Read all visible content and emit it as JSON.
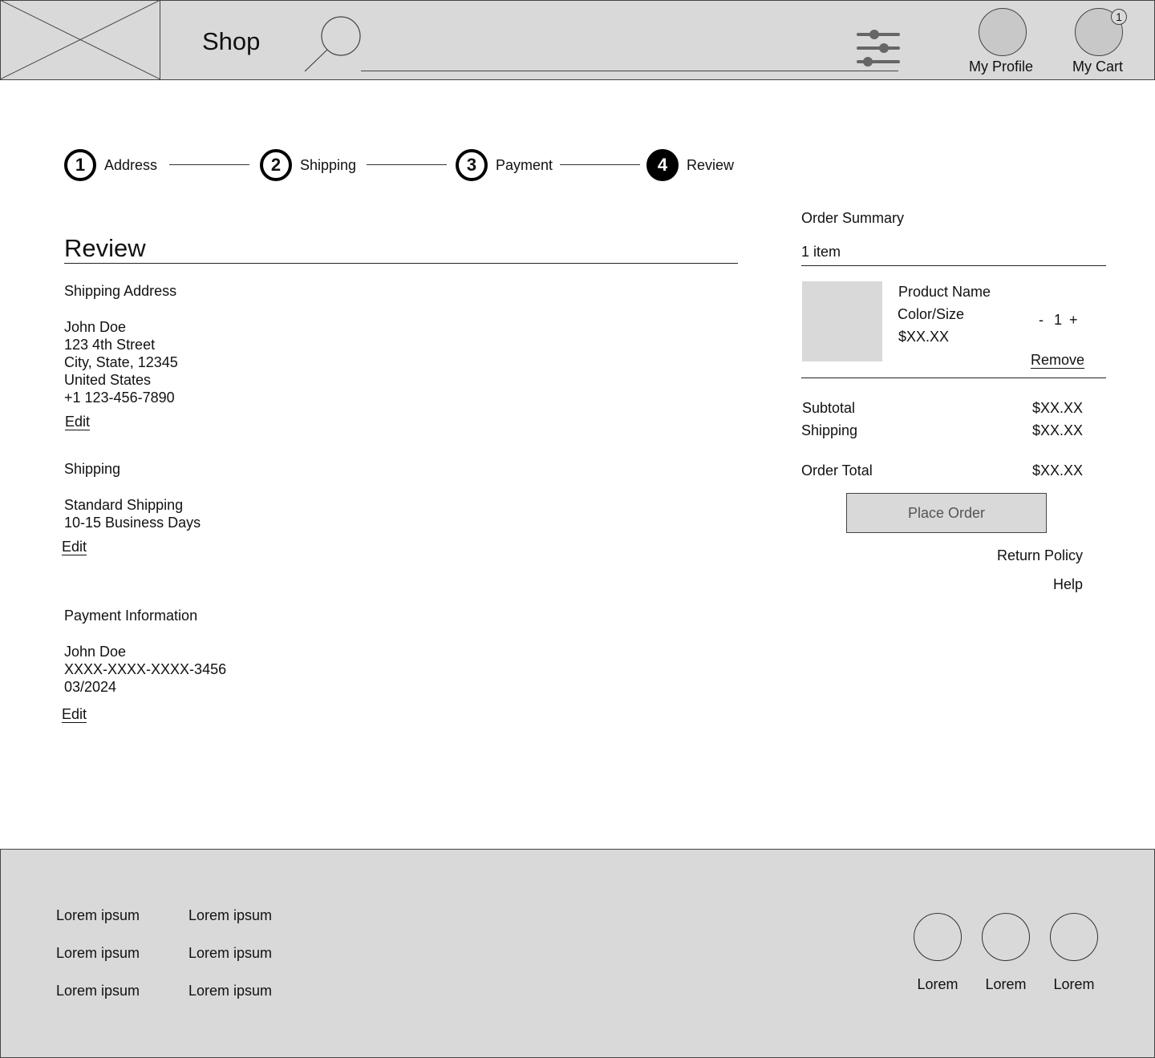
{
  "header": {
    "title": "Shop",
    "profile_label": "My Profile",
    "cart_label": "My Cart",
    "cart_count": "1"
  },
  "stepper": {
    "steps": [
      {
        "number": "1",
        "label": "Address"
      },
      {
        "number": "2",
        "label": "Shipping"
      },
      {
        "number": "3",
        "label": "Payment"
      },
      {
        "number": "4",
        "label": "Review"
      }
    ],
    "active_step": 4
  },
  "review": {
    "title": "Review",
    "shipping_address": {
      "heading": "Shipping Address",
      "lines": [
        "John Doe",
        "123 4th Street",
        "City, State, 12345",
        "United States",
        "+1 123-456-7890"
      ],
      "edit_label": "Edit"
    },
    "shipping": {
      "heading": "Shipping",
      "lines": [
        "Standard Shipping",
        "10-15 Business Days"
      ],
      "edit_label": "Edit"
    },
    "payment": {
      "heading": "Payment Information",
      "lines": [
        "John Doe",
        "XXXX-XXXX-XXXX-3456",
        "03/2024"
      ],
      "edit_label": "Edit"
    }
  },
  "summary": {
    "title": "Order Summary",
    "item_count": "1 item",
    "item": {
      "name": "Product Name",
      "variant": "Color/Size",
      "price": "$XX.XX",
      "qty_minus": "-",
      "qty": "1",
      "qty_plus": "+",
      "remove_label": "Remove"
    },
    "subtotal_label": "Subtotal",
    "subtotal_value": "$XX.XX",
    "shipping_label": "Shipping",
    "shipping_value": "$XX.XX",
    "total_label": "Order Total",
    "total_value": "$XX.XX",
    "place_order_label": "Place Order",
    "return_policy_label": "Return Policy",
    "help_label": "Help"
  },
  "footer": {
    "links": [
      [
        "Lorem ipsum",
        "Lorem ipsum",
        "Lorem ipsum"
      ],
      [
        "Lorem ipsum",
        "Lorem ipsum",
        "Lorem ipsum"
      ]
    ],
    "social_captions": [
      "Lorem",
      "Lorem",
      "Lorem"
    ]
  },
  "colors": {
    "panel_gray": "#d9d9d9",
    "line": "#444444",
    "active_step": "#000000"
  }
}
